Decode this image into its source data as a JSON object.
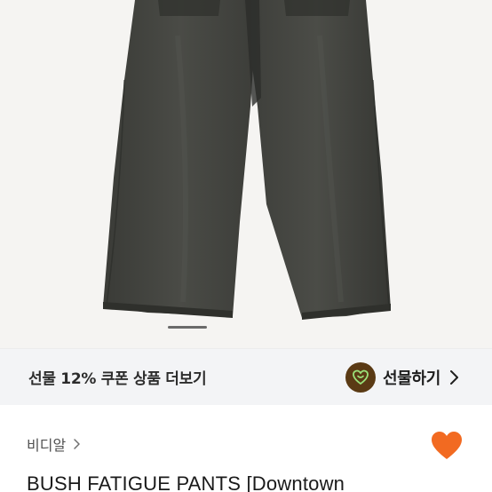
{
  "product_image": {
    "alt_subject": "pants-photo",
    "carousel_position": {
      "current": 1,
      "total": 5
    }
  },
  "gift_bar": {
    "coupon_text": "선물 12% 쿠폰 상품 더보기",
    "action_label": "선물하기",
    "icon": "gift-heart-icon",
    "icon_color": "#5a3a14"
  },
  "store": {
    "name": "비디알",
    "chevron_icon": "chevron-right-icon"
  },
  "favorite": {
    "icon": "heart-icon",
    "color": "#f26a21",
    "active": true
  },
  "product": {
    "title": "BUSH FATIGUE PANTS [Downtown"
  }
}
